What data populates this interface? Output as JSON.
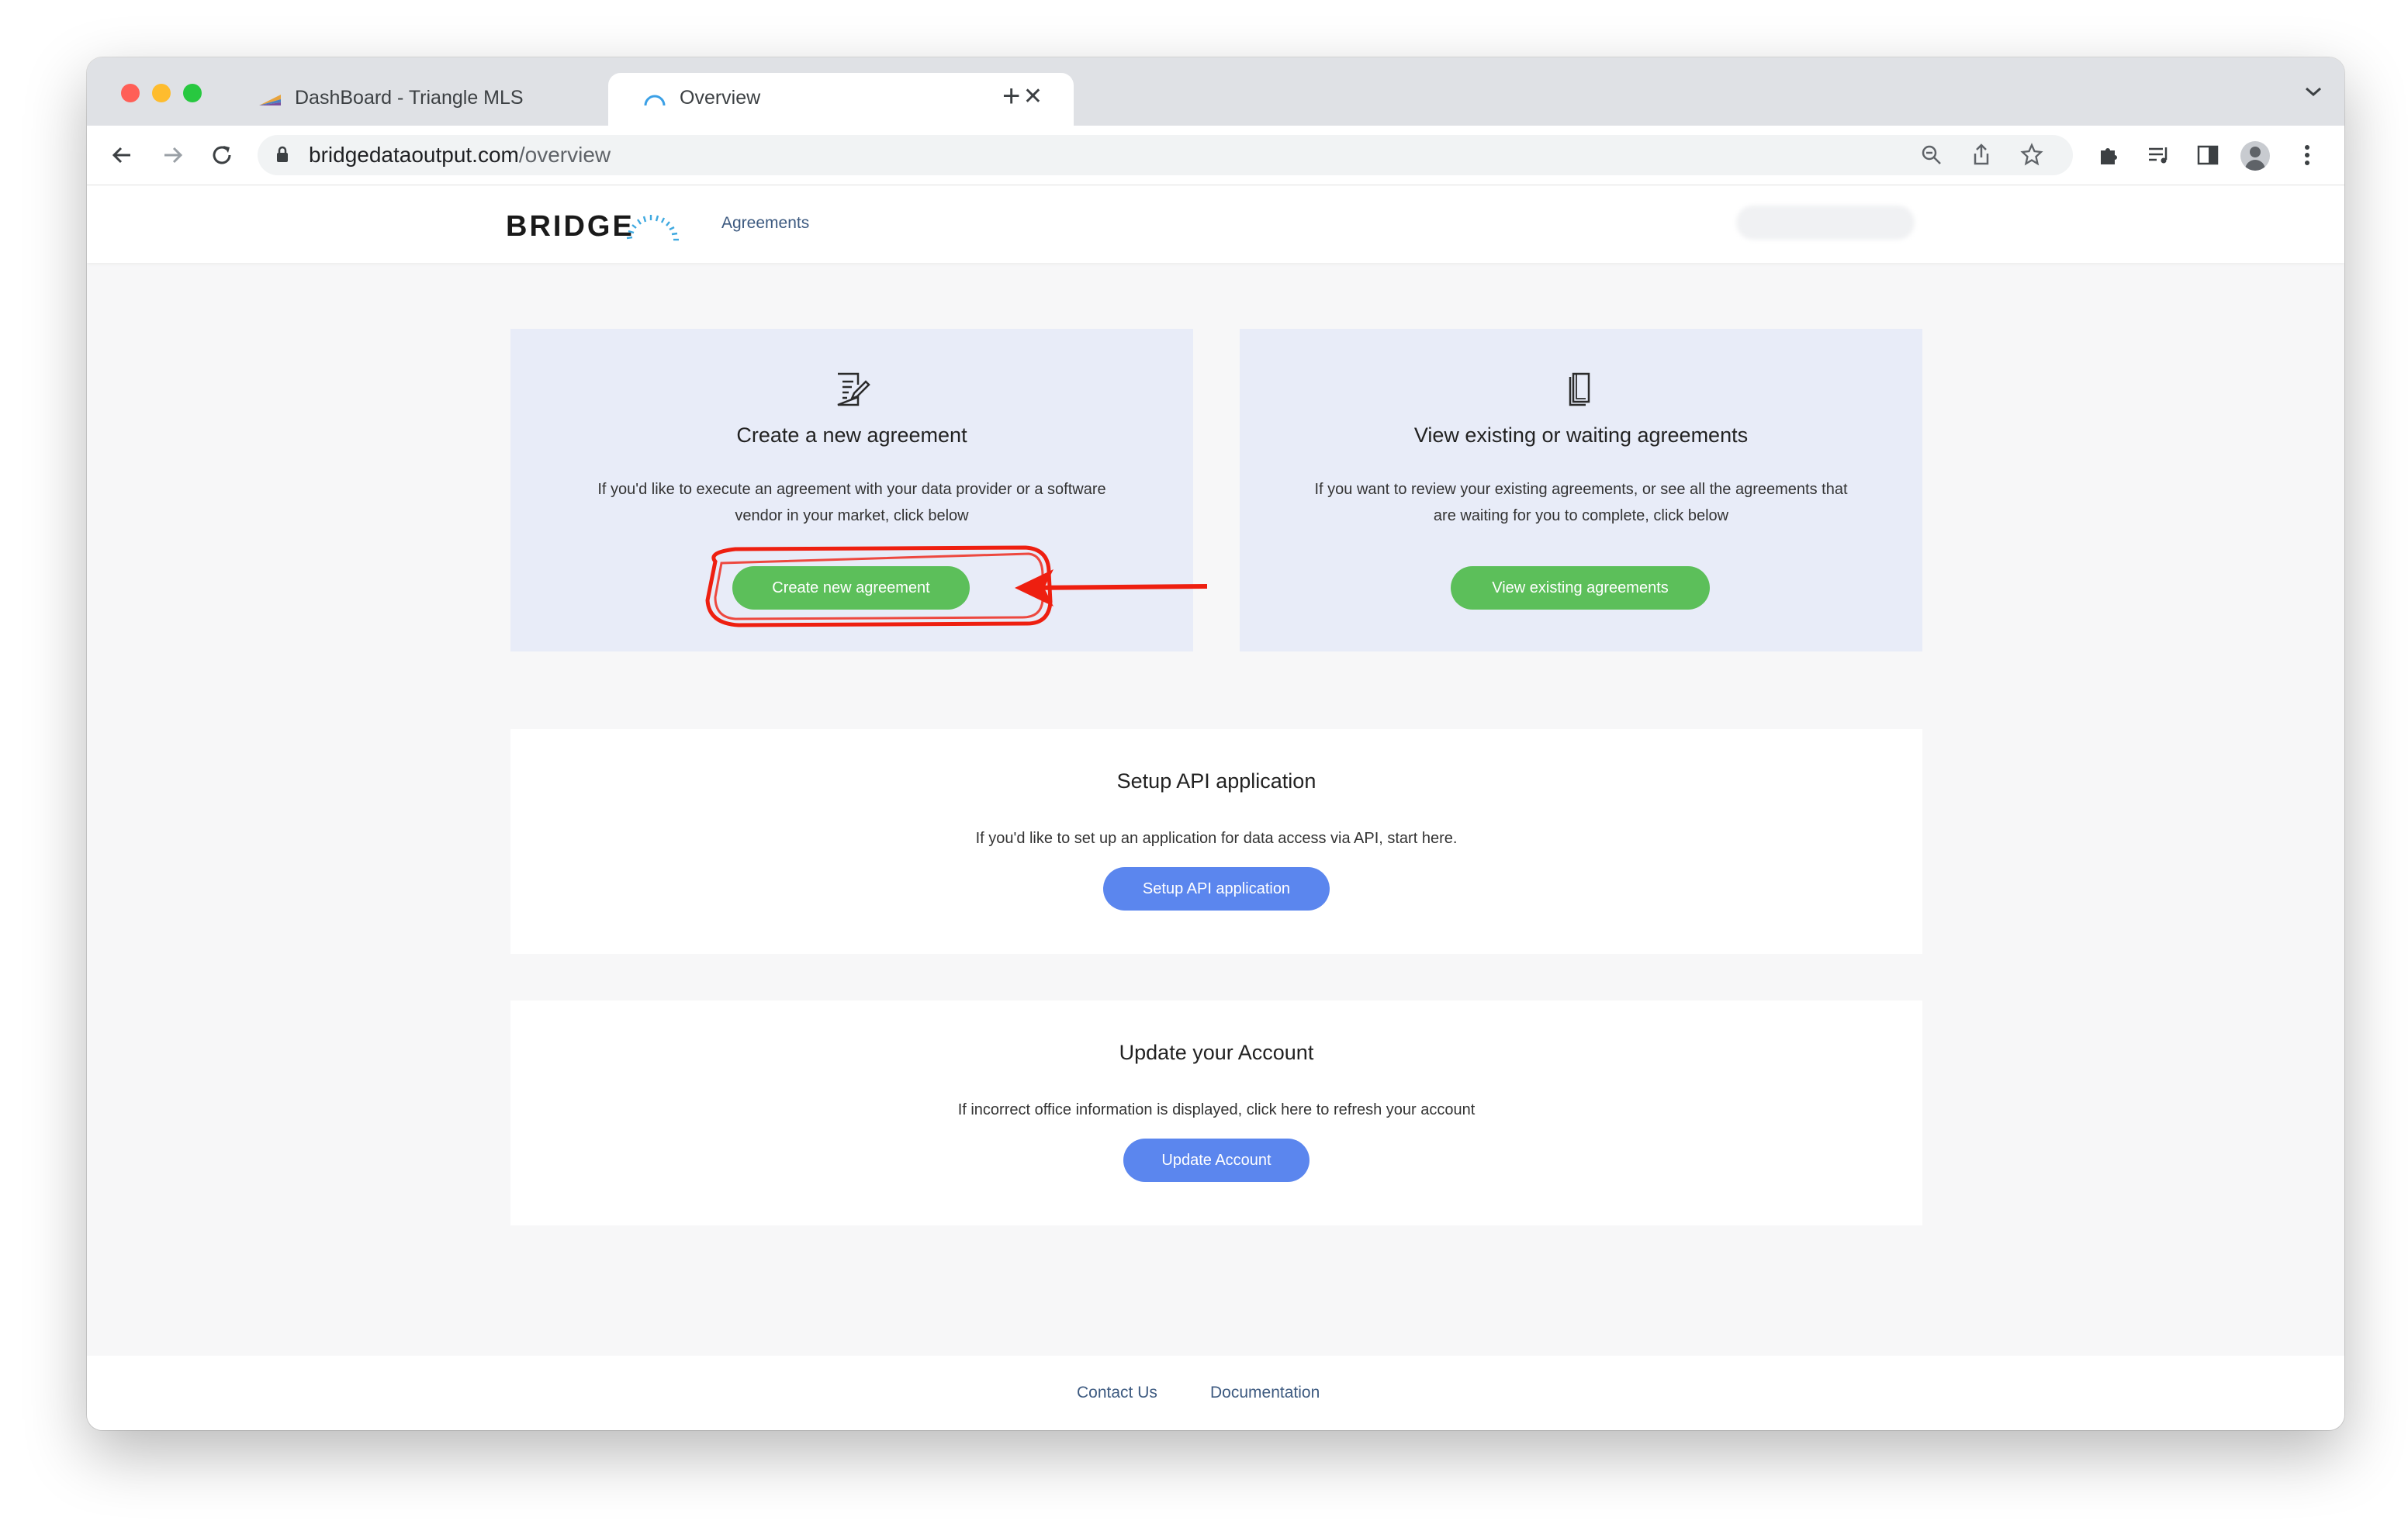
{
  "browser": {
    "tabs": [
      {
        "title": "DashBoard - Triangle MLS",
        "active": false
      },
      {
        "title": "Overview",
        "active": true
      }
    ],
    "new_tab_symbol": "+",
    "close_symbol": "✕",
    "url_host": "bridgedataoutput.com",
    "url_path": "/overview",
    "icons": [
      "back-arrow-icon",
      "forward-arrow-icon",
      "reload-icon",
      "lock-icon",
      "zoom-icon",
      "share-icon",
      "star-icon",
      "extensions-icon",
      "media-icon",
      "sidebar-icon",
      "profile-icon",
      "menu-icon"
    ]
  },
  "header": {
    "logo_text": "BRIDGE",
    "nav": [
      {
        "label": "Agreements"
      }
    ]
  },
  "cards": {
    "create": {
      "title": "Create a new agreement",
      "description_line1": "If you'd like to execute an agreement with your data provider or a software",
      "description_line2": "vendor in your market, click below",
      "button": "Create new agreement",
      "icon": "edit-document-icon"
    },
    "view": {
      "title": "View existing or waiting agreements",
      "description_line1": "If you want to review your existing agreements, or see all the agreements that",
      "description_line2": "are waiting for you to complete, click below",
      "button": "View existing agreements",
      "icon": "documents-icon"
    },
    "api": {
      "title": "Setup API application",
      "description": "If you'd like to set up an application for data access via API, start here.",
      "button": "Setup API application"
    },
    "account": {
      "title": "Update your Account",
      "description": "If incorrect office information is displayed, click here to refresh your account",
      "button": "Update Account"
    }
  },
  "footer": {
    "links": [
      {
        "label": "Contact Us"
      },
      {
        "label": "Documentation"
      }
    ]
  },
  "colors": {
    "green_button": "#5cbf5a",
    "blue_button": "#5b86ee",
    "card_blue": "#e8ecf8",
    "annotation_red": "#ee1f10",
    "link": "#3d5a80"
  }
}
